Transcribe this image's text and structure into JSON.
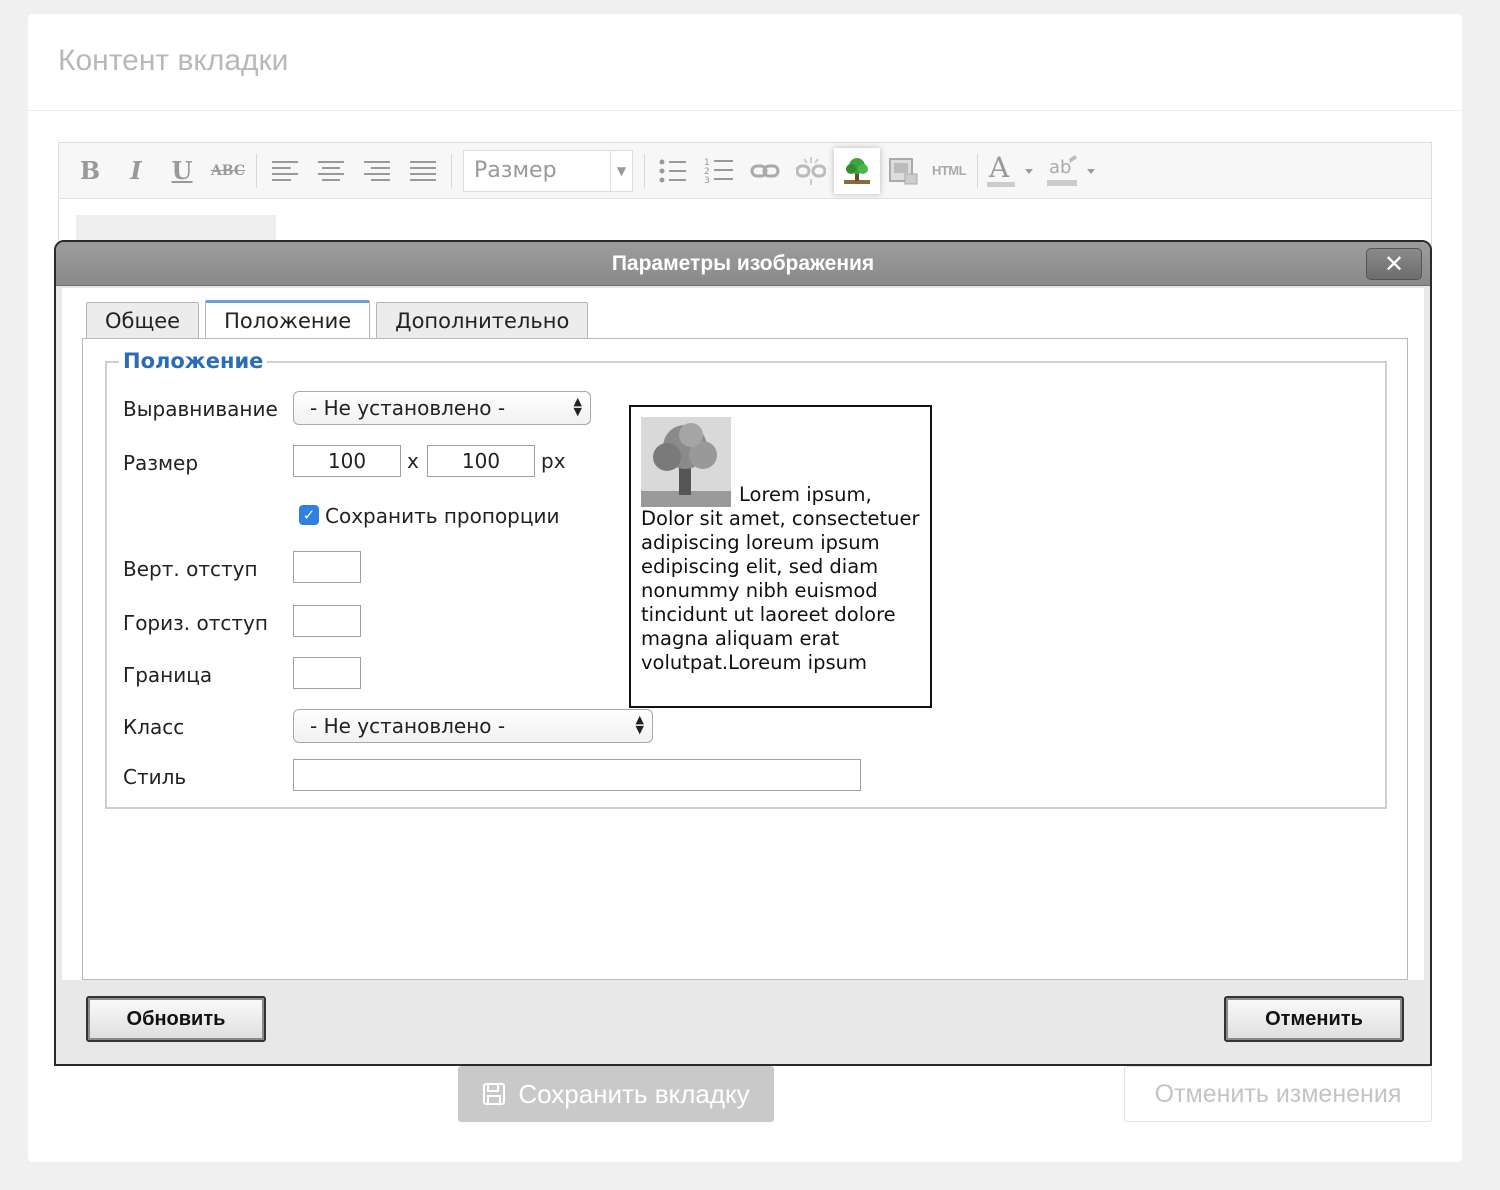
{
  "page": {
    "title": "Контент вкладки"
  },
  "toolbar": {
    "size_select": "Размер",
    "html_label": "HTML"
  },
  "dialog": {
    "title": "Параметры изображения",
    "close_label": "✕",
    "tabs": [
      {
        "label": "Общее",
        "active": false
      },
      {
        "label": "Положение",
        "active": true
      },
      {
        "label": "Дополнительно",
        "active": false
      }
    ],
    "legend": "Положение",
    "fields": {
      "align_label": "Выравнивание",
      "align_value": "- Не установлено -",
      "size_label": "Размер",
      "width_value": "100",
      "times": "x",
      "height_value": "100",
      "unit": "px",
      "keep_proportions_label": "Сохранить пропорции",
      "keep_proportions_checked": true,
      "vspace_label": "Верт. отступ",
      "vspace_value": "",
      "hspace_label": "Гориз. отступ",
      "hspace_value": "",
      "border_label": "Граница",
      "border_value": "",
      "class_label": "Класс",
      "class_value": "- Не установлено -",
      "style_label": "Стиль",
      "style_value": ""
    },
    "preview_text": "Lorem ipsum, Dolor sit amet, consectetuer adipiscing loreum ipsum edipiscing elit, sed diam nonummy nibh euismod tincidunt ut laoreet dolore magna aliquam erat volutpat.Loreum ipsum",
    "buttons": {
      "update": "Обновить",
      "cancel": "Отменить"
    }
  },
  "footer": {
    "save_tab": "Сохранить вкладку",
    "cancel_changes": "Отменить изменения"
  },
  "colors": {
    "accent_blue": "#2b6cb6",
    "checkbox_blue": "#2f7fe5",
    "titlebar_gray": "#8f8f8f"
  }
}
